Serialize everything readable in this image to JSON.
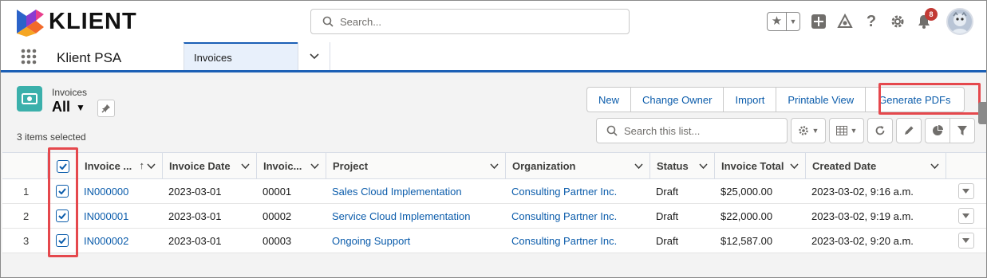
{
  "header": {
    "logo_text": "KLIENT",
    "search_placeholder": "Search...",
    "notification_count": "8"
  },
  "nav": {
    "app_name": "Klient PSA",
    "active_tab": "Invoices"
  },
  "list_view": {
    "object_label": "Invoices",
    "view_name": "All",
    "items_selected": "3 items selected",
    "buttons": [
      "New",
      "Change Owner",
      "Import",
      "Printable View",
      "Generate PDFs"
    ],
    "search_placeholder": "Search this list..."
  },
  "table": {
    "columns": [
      "Invoice ...",
      "Invoice Date",
      "Invoic...",
      "Project",
      "Organization",
      "Status",
      "Invoice Total",
      "Created Date"
    ],
    "rows": [
      {
        "num": "1",
        "invoice": "IN000000",
        "date": "2023-03-01",
        "number": "00001",
        "project": "Sales Cloud Implementation",
        "org": "Consulting Partner Inc.",
        "status": "Draft",
        "total": "$25,000.00",
        "created": "2023-03-02, 9:16 a.m."
      },
      {
        "num": "2",
        "invoice": "IN000001",
        "date": "2023-03-01",
        "number": "00002",
        "project": "Service Cloud Implementation",
        "org": "Consulting Partner Inc.",
        "status": "Draft",
        "total": "$22,000.00",
        "created": "2023-03-02, 9:19 a.m."
      },
      {
        "num": "3",
        "invoice": "IN000002",
        "date": "2023-03-01",
        "number": "00003",
        "project": "Ongoing Support",
        "org": "Consulting Partner Inc.",
        "status": "Draft",
        "total": "$12,587.00",
        "created": "2023-03-02, 9:20 a.m."
      }
    ]
  },
  "colors": {
    "accent": "#0b5cab",
    "nav_underline": "#1b5fb5",
    "highlight": "#e5484d",
    "object_icon": "#3bb0ab"
  }
}
